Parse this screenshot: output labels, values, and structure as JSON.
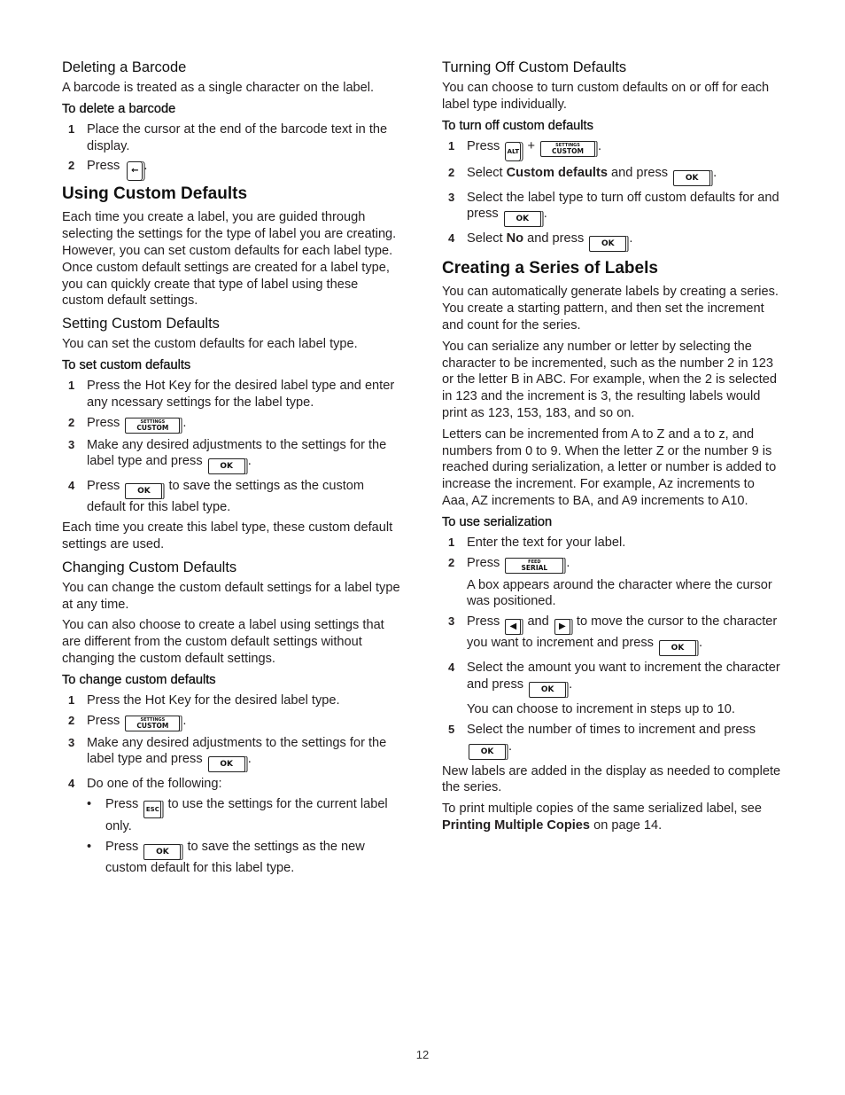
{
  "page_number": "12",
  "keys": {
    "backspace": "←",
    "settings_top": "SETTINGS",
    "settings_bottom": "CUSTOM",
    "ok": "OK",
    "alt": "ALT",
    "esc": "ESC",
    "feed_top": "FEED",
    "feed_bottom": "SERIAL",
    "left_arrow": "◀",
    "right_arrow": "▶"
  },
  "left": {
    "deleting": {
      "title": "Deleting a Barcode",
      "intro": "A barcode is treated as a single character on the label.",
      "procedure": "To delete a barcode",
      "step1_num": "1",
      "step1": "Place the cursor at the end of the barcode text in the display.",
      "step2_num": "2",
      "step2_pre": "Press",
      "step2_post": "."
    },
    "using": {
      "title": "Using Custom Defaults",
      "body": "Each time you create a label, you are guided through selecting the settings for the type of label you are creating. However, you can set custom defaults for each label type. Once custom default settings are created for a label type, you can quickly create that type of label using these custom default settings."
    },
    "setting": {
      "title": "Setting Custom Defaults",
      "intro": "You can set the custom defaults for each label type.",
      "procedure": "To set custom defaults",
      "step1_num": "1",
      "step1": "Press the Hot Key for the desired label type and enter any ncessary settings for the label type.",
      "step2_num": "2",
      "step2_pre": "Press",
      "step2_post": ".",
      "step3_num": "3",
      "step3_pre": "Make any desired adjustments to the settings for the label type and press",
      "step3_post": ".",
      "step4_num": "4",
      "step4_pre": "Press",
      "step4_post": "to save the settings as the custom default for this label type.",
      "outro": "Each time you create this label type, these custom default settings are used."
    },
    "changing": {
      "title": "Changing Custom Defaults",
      "p1": "You can change the custom default settings for a label type at any time.",
      "p2": "You can also choose to create a label using settings that are different from the custom default settings without changing the custom default settings.",
      "procedure": "To change custom defaults",
      "step1_num": "1",
      "step1": "Press the Hot Key for the desired label type.",
      "step2_num": "2",
      "step2_pre": "Press",
      "step2_post": ".",
      "step3_num": "3",
      "step3_pre": "Make any desired adjustments to the settings for the label type and press",
      "step3_post": ".",
      "step4_num": "4",
      "step4": "Do one of the following:",
      "bullet_char": "•",
      "bullet1_pre": "Press",
      "bullet1_post": "to use the settings for the current label only.",
      "bullet2_pre": "Press",
      "bullet2_post": "to save the settings as the new custom default for this label type."
    }
  },
  "right": {
    "turning_off": {
      "title": "Turning Off Custom Defaults",
      "intro": "You can choose to turn custom defaults on or off for each label type individually.",
      "procedure": "To turn off custom defaults",
      "step1_num": "1",
      "step1_pre": "Press",
      "step1_plus": "+",
      "step1_post": ".",
      "step2_num": "2",
      "step2_pre": "Select",
      "step2_bold": "Custom defaults",
      "step2_mid": "and press",
      "step2_post": ".",
      "step3_num": "3",
      "step3_pre": "Select the label type to turn off custom defaults for and press",
      "step3_post": ".",
      "step4_num": "4",
      "step4_pre": "Select",
      "step4_bold": "No",
      "step4_mid": "and press",
      "step4_post": "."
    },
    "series": {
      "title": "Creating a Series of Labels",
      "p1": "You can automatically generate labels by creating a series. You create a starting pattern, and then set the increment and count for the series.",
      "p2": "You can serialize any number or letter by selecting the character to be incremented, such as the number 2 in 123 or the letter B in ABC. For example, when the 2 is selected in 123 and the increment is 3, the resulting labels would print as 123, 153, 183, and so on.",
      "p3": "Letters can be incremented from A to Z and a to z, and numbers from 0 to 9. When the letter Z or the number 9 is reached during serialization, a letter or number is added to increase the increment. For example, Az increments to Aaa, AZ increments to BA, and A9 increments to A10.",
      "procedure": "To use serialization",
      "step1_num": "1",
      "step1": "Enter the text for your label.",
      "step2_num": "2",
      "step2_pre": "Press",
      "step2_post": ".",
      "step2_note": "A box appears around the character where the cursor was positioned.",
      "step3_num": "3",
      "step3_pre": "Press",
      "step3_and": "and",
      "step3_mid": "to move the cursor to the character you want to increment and press",
      "step3_post": ".",
      "step4_num": "4",
      "step4_pre": "Select the amount you want to increment the character and press",
      "step4_post": ".",
      "step4_note": "You can choose to increment in steps up to 10.",
      "step5_num": "5",
      "step5_pre": "Select the number of times to increment and press",
      "step5_post": ".",
      "p4": "New labels are added in the display as needed to complete the series.",
      "p5_pre": "To print multiple copies of the same serialized label, see",
      "p5_bold": "Printing Multiple Copies",
      "p5_post": "on page 14."
    }
  }
}
